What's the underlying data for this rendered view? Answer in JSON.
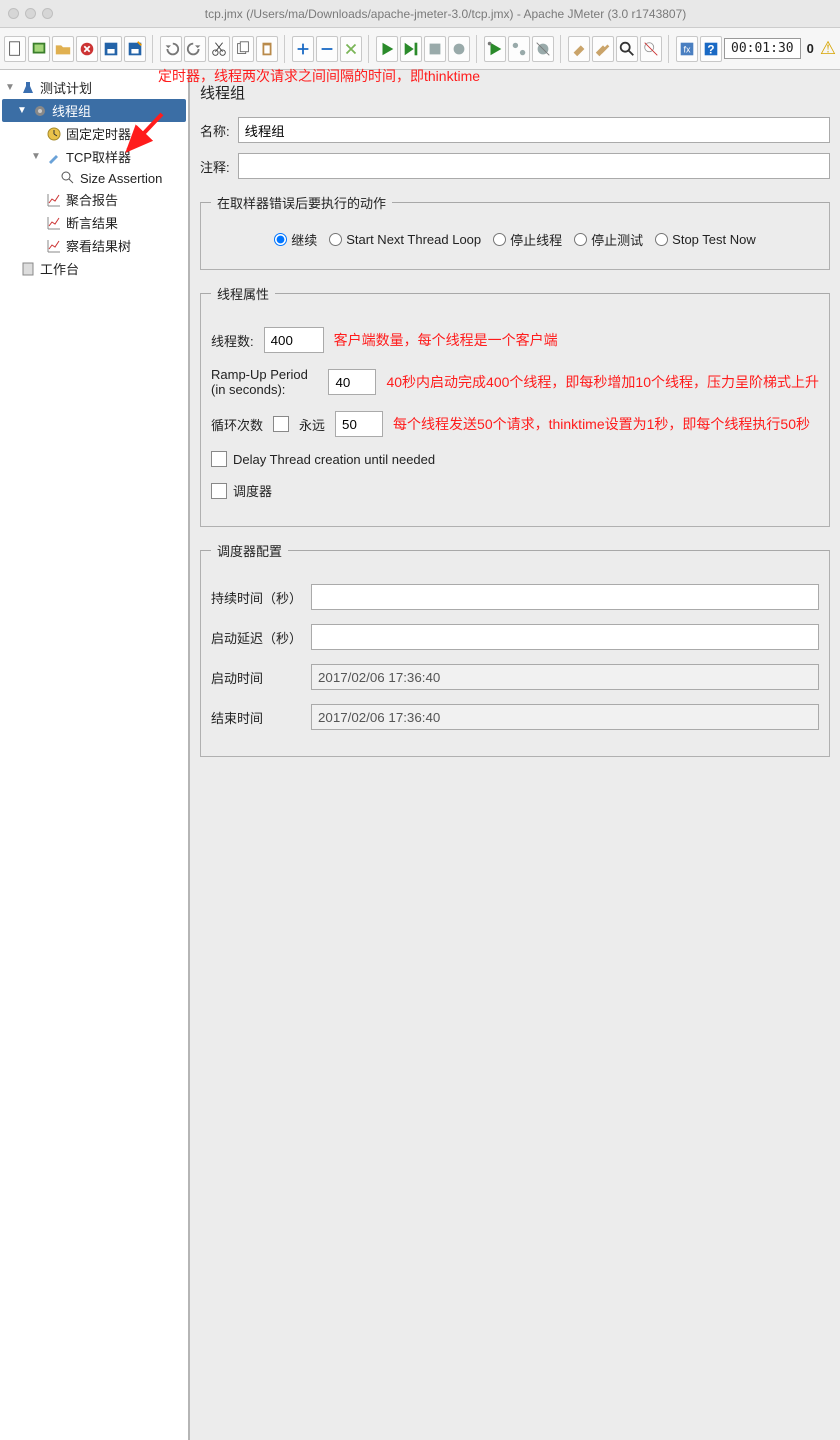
{
  "window": {
    "title": "tcp.jmx (/Users/ma/Downloads/apache-jmeter-3.0/tcp.jmx) - Apache JMeter (3.0 r1743807)"
  },
  "toolbar": {
    "elapsed": "00:01:30",
    "count": "0"
  },
  "tree": {
    "root": "测试计划",
    "threadGroup": "线程组",
    "timer": "固定定时器",
    "tcpSampler": "TCP取样器",
    "sizeAssertion": "Size Assertion",
    "aggregate": "聚合报告",
    "assertionResult": "断言结果",
    "viewResultsTree": "察看结果树",
    "workbench": "工作台"
  },
  "annotations": {
    "top": "定时器，线程两次请求之间间隔的时间，即thinktime",
    "threads": "客户端数量，每个线程是一个客户端",
    "rampup": "40秒内启动完成400个线程，即每秒增加10个线程，压力呈阶梯式上升",
    "loops": "每个线程发送50个请求，thinktime设置为1秒，即每个线程执行50秒"
  },
  "panel": {
    "title": "线程组",
    "nameLabel": "名称:",
    "nameValue": "线程组",
    "commentLabel": "注释:",
    "commentValue": "",
    "errorGroup": "在取样器错误后要执行的动作",
    "radios": {
      "continue": "继续",
      "nextLoop": "Start Next Thread Loop",
      "stopThread": "停止线程",
      "abort": "停止测试",
      "stopNow": "Stop Test Now"
    },
    "threadProps": "线程属性",
    "threadsLabel": "线程数:",
    "threadsValue": "400",
    "rampLabel": "Ramp-Up Period (in seconds):",
    "rampValue": "40",
    "loopLabel": "循环次数",
    "loopForever": "永远",
    "loopValue": "50",
    "delayThread": "Delay Thread creation until needed",
    "scheduler": "调度器",
    "schedulerConfig": "调度器配置",
    "duration": "持续时间（秒）",
    "durationValue": "",
    "delay": "启动延迟（秒）",
    "delayValue": "",
    "startTime": "启动时间",
    "startTimeValue": "2017/02/06 17:36:40",
    "endTime": "结束时间",
    "endTimeValue": "2017/02/06 17:36:40"
  }
}
